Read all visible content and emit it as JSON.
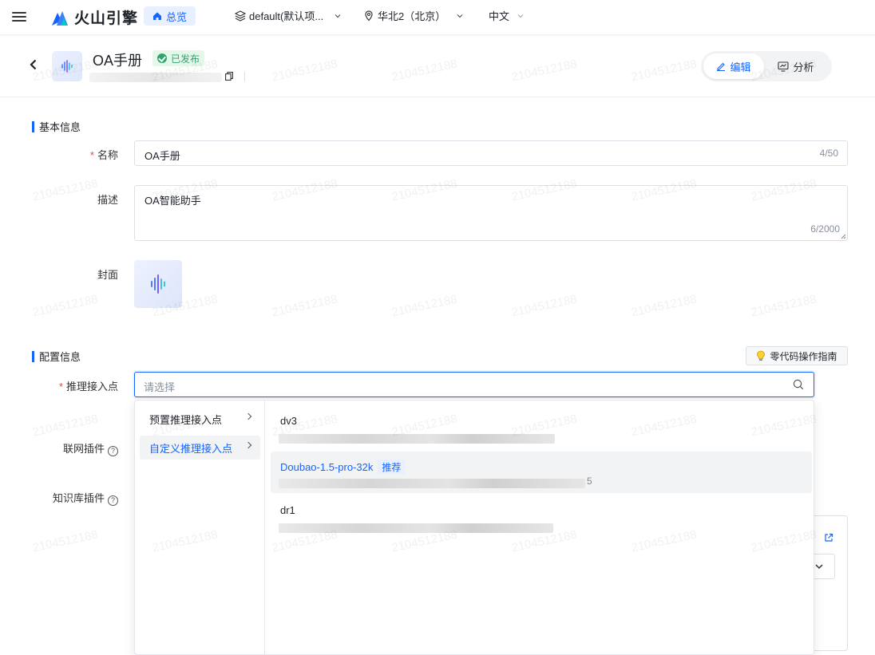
{
  "topbar": {
    "brand": "火山引擎",
    "home_label": "总览",
    "project_label": "default(默认项...",
    "region_label": "华北2（北京）",
    "language_label": "中文"
  },
  "app": {
    "title": "OA手册",
    "status": "已发布",
    "mode_edit": "编辑",
    "mode_analyze": "分析"
  },
  "basic": {
    "section_title": "基本信息",
    "name_label": "名称",
    "name_value": "OA手册",
    "name_counter": "4/50",
    "desc_label": "描述",
    "desc_value": "OA智能助手",
    "desc_counter": "6/2000",
    "cover_label": "封面"
  },
  "config": {
    "section_title": "配置信息",
    "guide_button": "零代码操作指南",
    "endpoint_label": "推理接入点",
    "endpoint_placeholder": "请选择",
    "web_plugin_label": "联网插件",
    "kb_plugin_label": "知识库插件"
  },
  "dropdown": {
    "categories": [
      {
        "label": "预置推理接入点"
      },
      {
        "label": "自定义推理接入点"
      }
    ],
    "options": [
      {
        "name": "dv3",
        "tag": "",
        "tail": ""
      },
      {
        "name": "Doubao-1.5-pro-32k",
        "tag": "推荐",
        "tail": "5"
      },
      {
        "name": "dr1",
        "tag": "",
        "tail": ""
      }
    ]
  },
  "watermark": "2104512188",
  "colors": {
    "primary": "#1664ff",
    "success": "#30a46c",
    "required": "#e5484d"
  }
}
